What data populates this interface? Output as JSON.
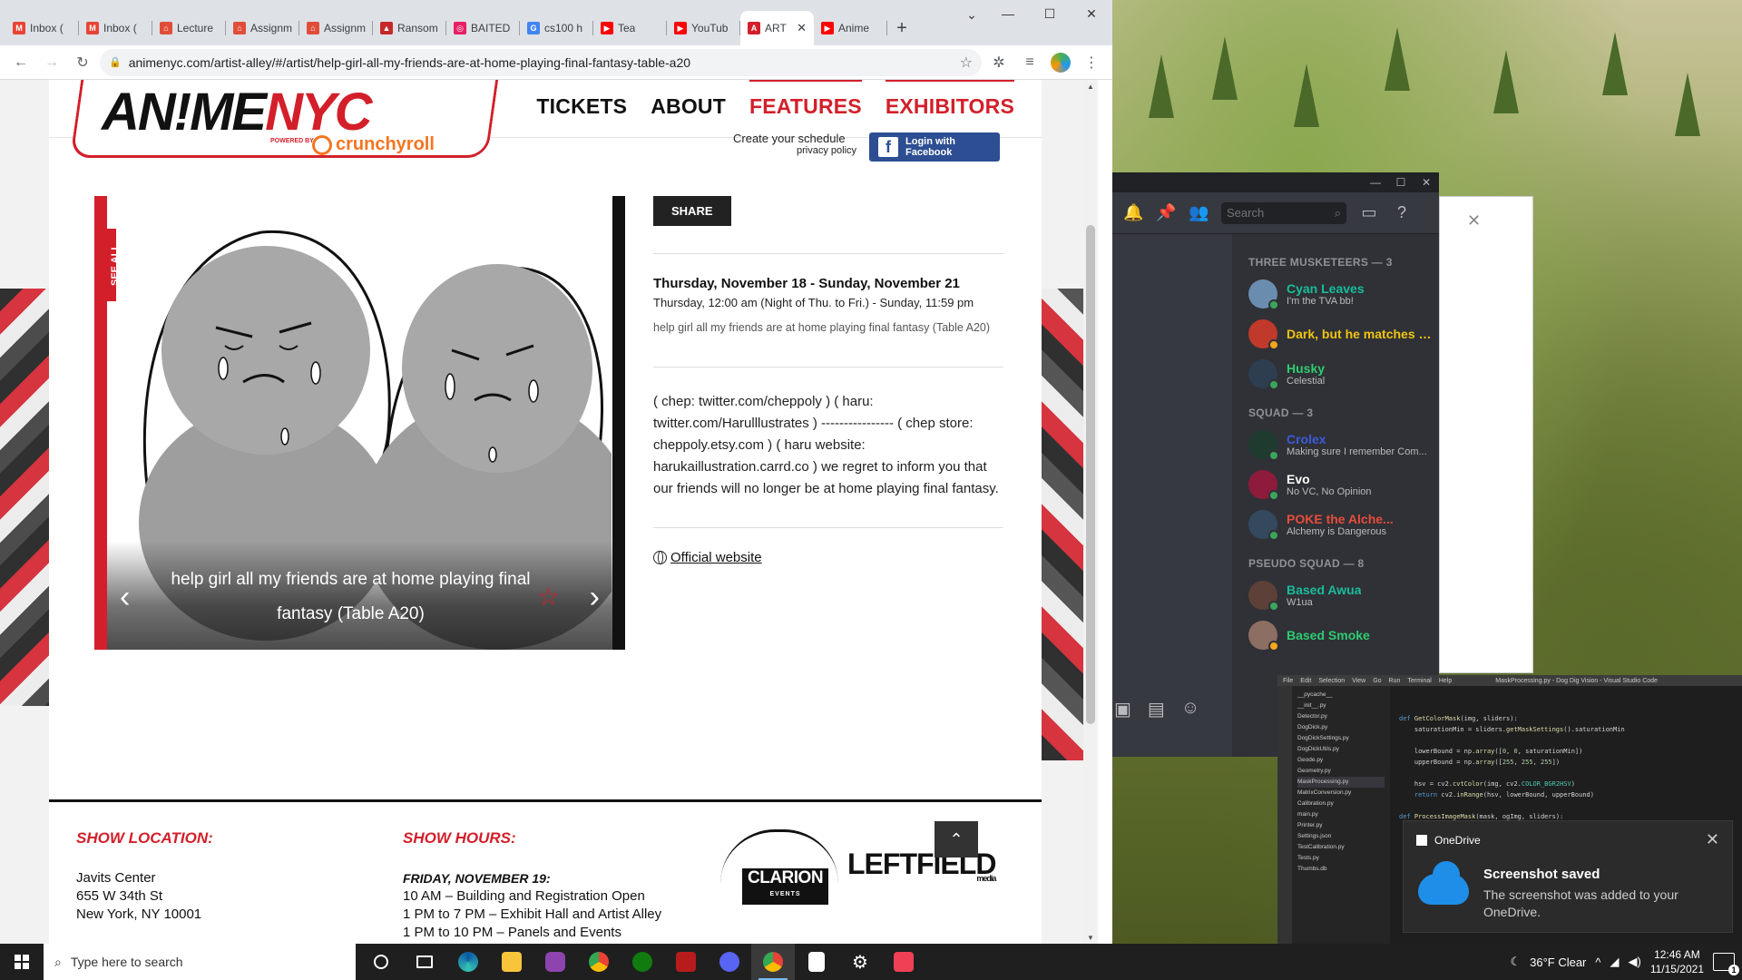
{
  "browser": {
    "tabs": [
      {
        "label": "Inbox (",
        "color": "#ea4335",
        "glyph": "M"
      },
      {
        "label": "Inbox (",
        "color": "#ea4335",
        "glyph": "M"
      },
      {
        "label": "Lecture",
        "color": "#e04e39",
        "glyph": "⌂"
      },
      {
        "label": "Assignm",
        "color": "#e04e39",
        "glyph": "⌂"
      },
      {
        "label": "Assignm",
        "color": "#e04e39",
        "glyph": "⌂"
      },
      {
        "label": "Ransom",
        "color": "#c62828",
        "glyph": "▲"
      },
      {
        "label": "BAITED",
        "color": "#e91e63",
        "glyph": "◎"
      },
      {
        "label": "cs100 h",
        "color": "#4285f4",
        "glyph": "G"
      },
      {
        "label": "Tea",
        "color": "#ff0000",
        "glyph": "▶"
      },
      {
        "label": "YouTub",
        "color": "#ff0000",
        "glyph": "▶"
      },
      {
        "label": "ART",
        "color": "#d31f2a",
        "glyph": "A"
      },
      {
        "label": "Anime",
        "color": "#ff0000",
        "glyph": "▶"
      }
    ],
    "url": "animenyc.com/artist-alley/#/artist/help-girl-all-my-friends-are-at-home-playing-final-fantasy-table-a20"
  },
  "site": {
    "logo_main": "AN!ME",
    "logo_accent": "NYC",
    "logo_powered": "POWERED BY",
    "logo_partner": "crunchyroll",
    "nav": [
      "TICKETS",
      "ABOUT",
      "FEATURES",
      "EXHIBITORS"
    ],
    "schedule_text": "Create your schedule",
    "privacy": "privacy policy",
    "fb_login": "Login with Facebook"
  },
  "slider": {
    "see_all": "SEE ALL",
    "caption": "help girl all my friends are at home playing final fantasy (Table A20)"
  },
  "detail": {
    "share": "SHARE",
    "date_title": "Thursday, November 18 - Sunday, November 21",
    "date_time": "Thursday, 12:00 am (Night of Thu. to Fri.) - Sunday, 11:59 pm",
    "event_name": "help girl all my friends are at home playing final fantasy (Table A20)",
    "description": "( chep: twitter.com/cheppoly ) ( haru: twitter.com/Harulllustrates ) ---------------- ( chep store: cheppoly.etsy.com ) ( haru website: harukaillustration.carrd.co ) we regret to inform you that our friends will no longer be at home playing final fantasy.",
    "website": "Official website"
  },
  "footer": {
    "location_head": "SHOW LOCATION:",
    "location_lines": [
      "Javits Center",
      "655 W 34th St",
      "New York, NY 10001"
    ],
    "hours_head": "SHOW HOURS:",
    "hours_day": "FRIDAY, NOVEMBER 19:",
    "hours_lines": [
      "10 AM – Building and Registration Open",
      "1 PM to 7 PM – Exhibit Hall and Artist Alley",
      "1 PM to 10 PM – Panels and Events"
    ],
    "sponsor1": "CLARION",
    "sponsor1_sub": "EVENTS",
    "sponsor2": "LEFTFIELD",
    "sponsor2_sub": "media"
  },
  "discord": {
    "search_placeholder": "Search",
    "groups": [
      {
        "title": "THREE MUSKETEERS — 3",
        "members": [
          {
            "name": "Cyan Leaves",
            "status": "I'm the TVA bb!",
            "color": "#1abc9c",
            "av": "#6a8caf",
            "st": "#3ba55c"
          },
          {
            "name": "Dark, but he matches t...",
            "status": "",
            "color": "#f1c40f",
            "av": "#c0392b",
            "st": "#faa61a"
          },
          {
            "name": "Husky",
            "status": "Celestial",
            "color": "#2ecc71",
            "av": "#2c3e50",
            "st": "#3ba55c"
          }
        ]
      },
      {
        "title": "SQUAD — 3",
        "members": [
          {
            "name": "Crolex",
            "status": "Making sure I remember Com...",
            "color": "#3b5bdb",
            "av": "#1f3a2f",
            "st": "#3ba55c"
          },
          {
            "name": "Evo",
            "status": "No VC, No Opinion",
            "color": "#ffffff",
            "av": "#8e1b3c",
            "st": "#3ba55c"
          },
          {
            "name": "POKE the Alche...",
            "status": "Alchemy is Dangerous",
            "color": "#e74c3c",
            "av": "#34495e",
            "st": "#3ba55c"
          }
        ]
      },
      {
        "title": "PSEUDO SQUAD — 8",
        "members": [
          {
            "name": "Based Awua",
            "status": "W1ua",
            "color": "#1abc9c",
            "av": "#5d4037",
            "st": "#3ba55c"
          },
          {
            "name": "Based Smoke",
            "status": "",
            "color": "#2ecc71",
            "av": "#8d6e63",
            "st": "#faa61a"
          }
        ]
      }
    ]
  },
  "vscode": {
    "title": "MaskProcessing.py - Dog Dig Vision - Visual Studio Code",
    "menu": [
      "File",
      "Edit",
      "Selection",
      "View",
      "Go",
      "Run",
      "Terminal",
      "Help"
    ],
    "files": [
      "__pycache__",
      "__init__.py",
      "Detector.py",
      "DogDick.py",
      "DogDickSettings.py",
      "DogDickUtils.py",
      "Geode.py",
      "Geometry.py",
      "MaskProcessing.py",
      "MatrixConversion.py",
      "Calibration.py",
      "main.py",
      "Printer.py",
      "Settings.json",
      "TestCalibration.py",
      "Tests.py",
      "Thumbs.db"
    ]
  },
  "toast": {
    "app": "OneDrive",
    "title": "Screenshot saved",
    "body": "The screenshot was added to your OneDrive."
  },
  "taskbar": {
    "search_placeholder": "Type here to search",
    "weather": "36°F  Clear",
    "time": "12:46 AM",
    "date": "11/15/2021"
  }
}
